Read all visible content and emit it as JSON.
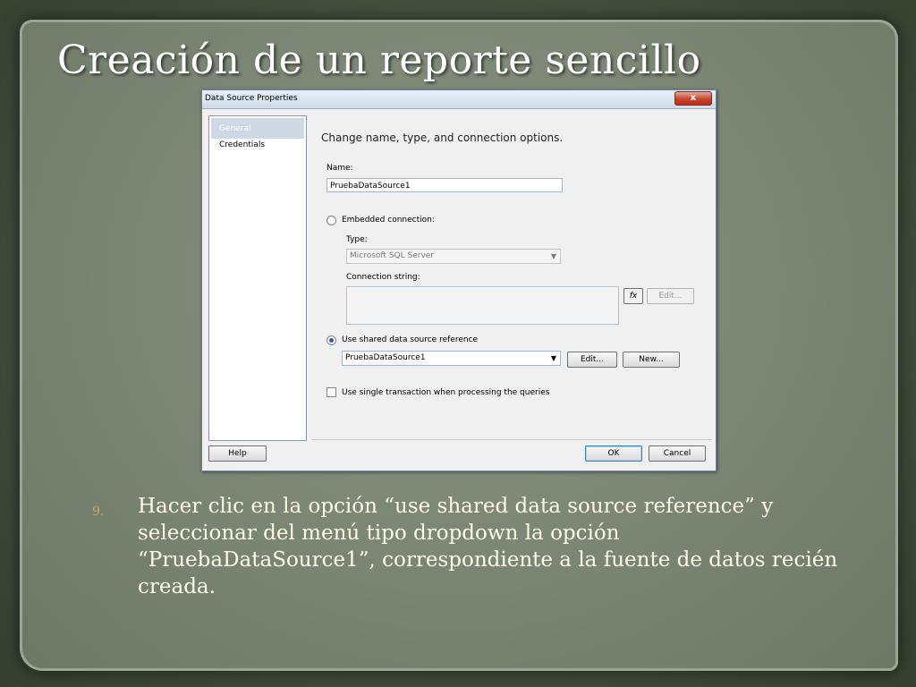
{
  "slide": {
    "title": "Creación de un reporte sencillo",
    "bullet_number": "9.",
    "bullet_text": "Hacer clic en la opción “use shared data source reference” y seleccionar del menú tipo dropdown la opción “PruebaDataSource1”, correspondiente a la fuente de datos recién creada."
  },
  "dialog": {
    "title": "Data Source Properties",
    "close_label": "x",
    "nav": [
      {
        "label": "General",
        "selected": true
      },
      {
        "label": "Credentials",
        "selected": false
      }
    ],
    "heading": "Change name, type, and connection options.",
    "name_label": "Name:",
    "name_value": "PruebaDataSource1",
    "embedded_label": "Embedded connection:",
    "type_label": "Type:",
    "type_value": "Microsoft SQL Server",
    "connection_string_label": "Connection string:",
    "fx_label": "fx",
    "edit_disabled_label": "Edit...",
    "shared_label": "Use shared data source reference",
    "shared_value": "PruebaDataSource1",
    "edit_label": "Edit...",
    "new_label": "New...",
    "single_transaction_label": "Use single transaction when processing the queries",
    "help_label": "Help",
    "ok_label": "OK",
    "cancel_label": "Cancel"
  },
  "colors": {
    "background": "#3e4a39",
    "paper": "#7a8673",
    "title_text": "#ffffff",
    "bullet_number": "#d9a04f",
    "bullet_text": "#fffbe6"
  }
}
